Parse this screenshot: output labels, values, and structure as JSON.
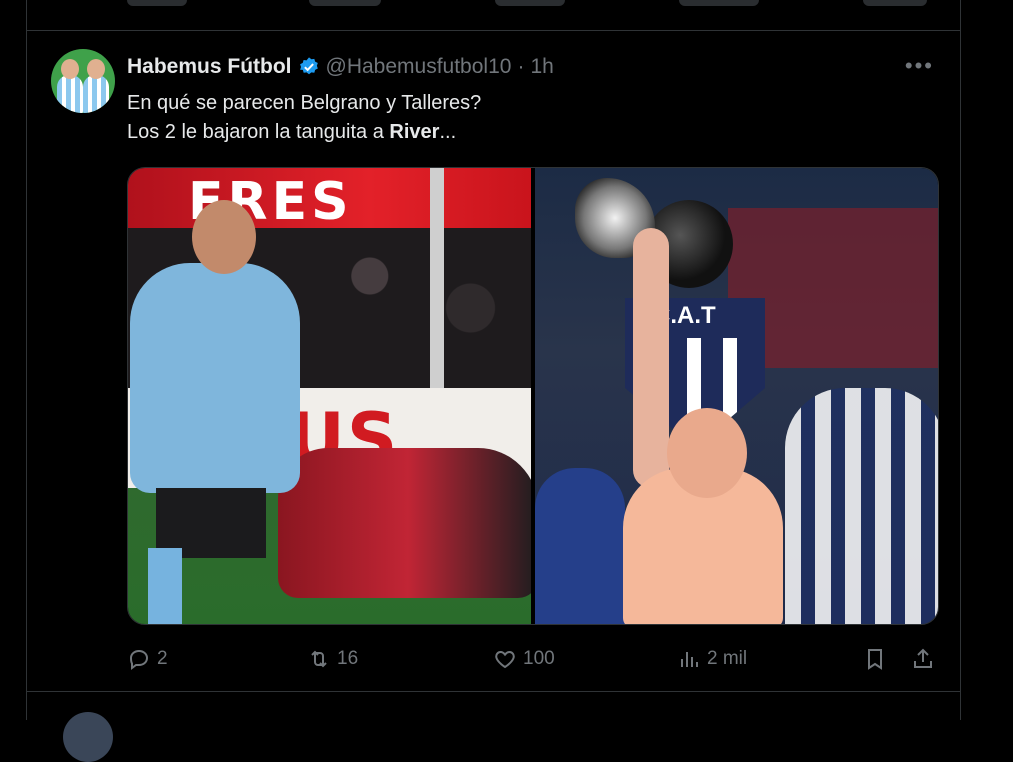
{
  "tweet": {
    "display_name": "Habemus Fútbol",
    "handle": "@Habemusfutbol10",
    "separator": "·",
    "time": "1h",
    "more_label": "•••",
    "text_line1": "En qué se parecen Belgrano y Talleres?",
    "text_line2_prefix": "Los 2 le bajaron la tanguita a ",
    "text_line2_bold": "River",
    "text_line2_suffix": "...",
    "media": {
      "left_banner_text": "ERES",
      "left_board_text": "US",
      "right_crest_text": "C.A.T"
    },
    "actions": {
      "reply_count": "2",
      "retweet_count": "16",
      "like_count": "100",
      "views_count": "2 mil"
    },
    "icons": {
      "verified": "verified-badge-icon",
      "reply": "reply-icon",
      "retweet": "retweet-icon",
      "like": "heart-icon",
      "views": "views-icon",
      "bookmark": "bookmark-icon",
      "share": "share-icon"
    }
  },
  "colors": {
    "background": "#000000",
    "text": "#e7e9ea",
    "muted": "#71767b",
    "border": "#2f3336",
    "verified": "#1d9bf0"
  }
}
